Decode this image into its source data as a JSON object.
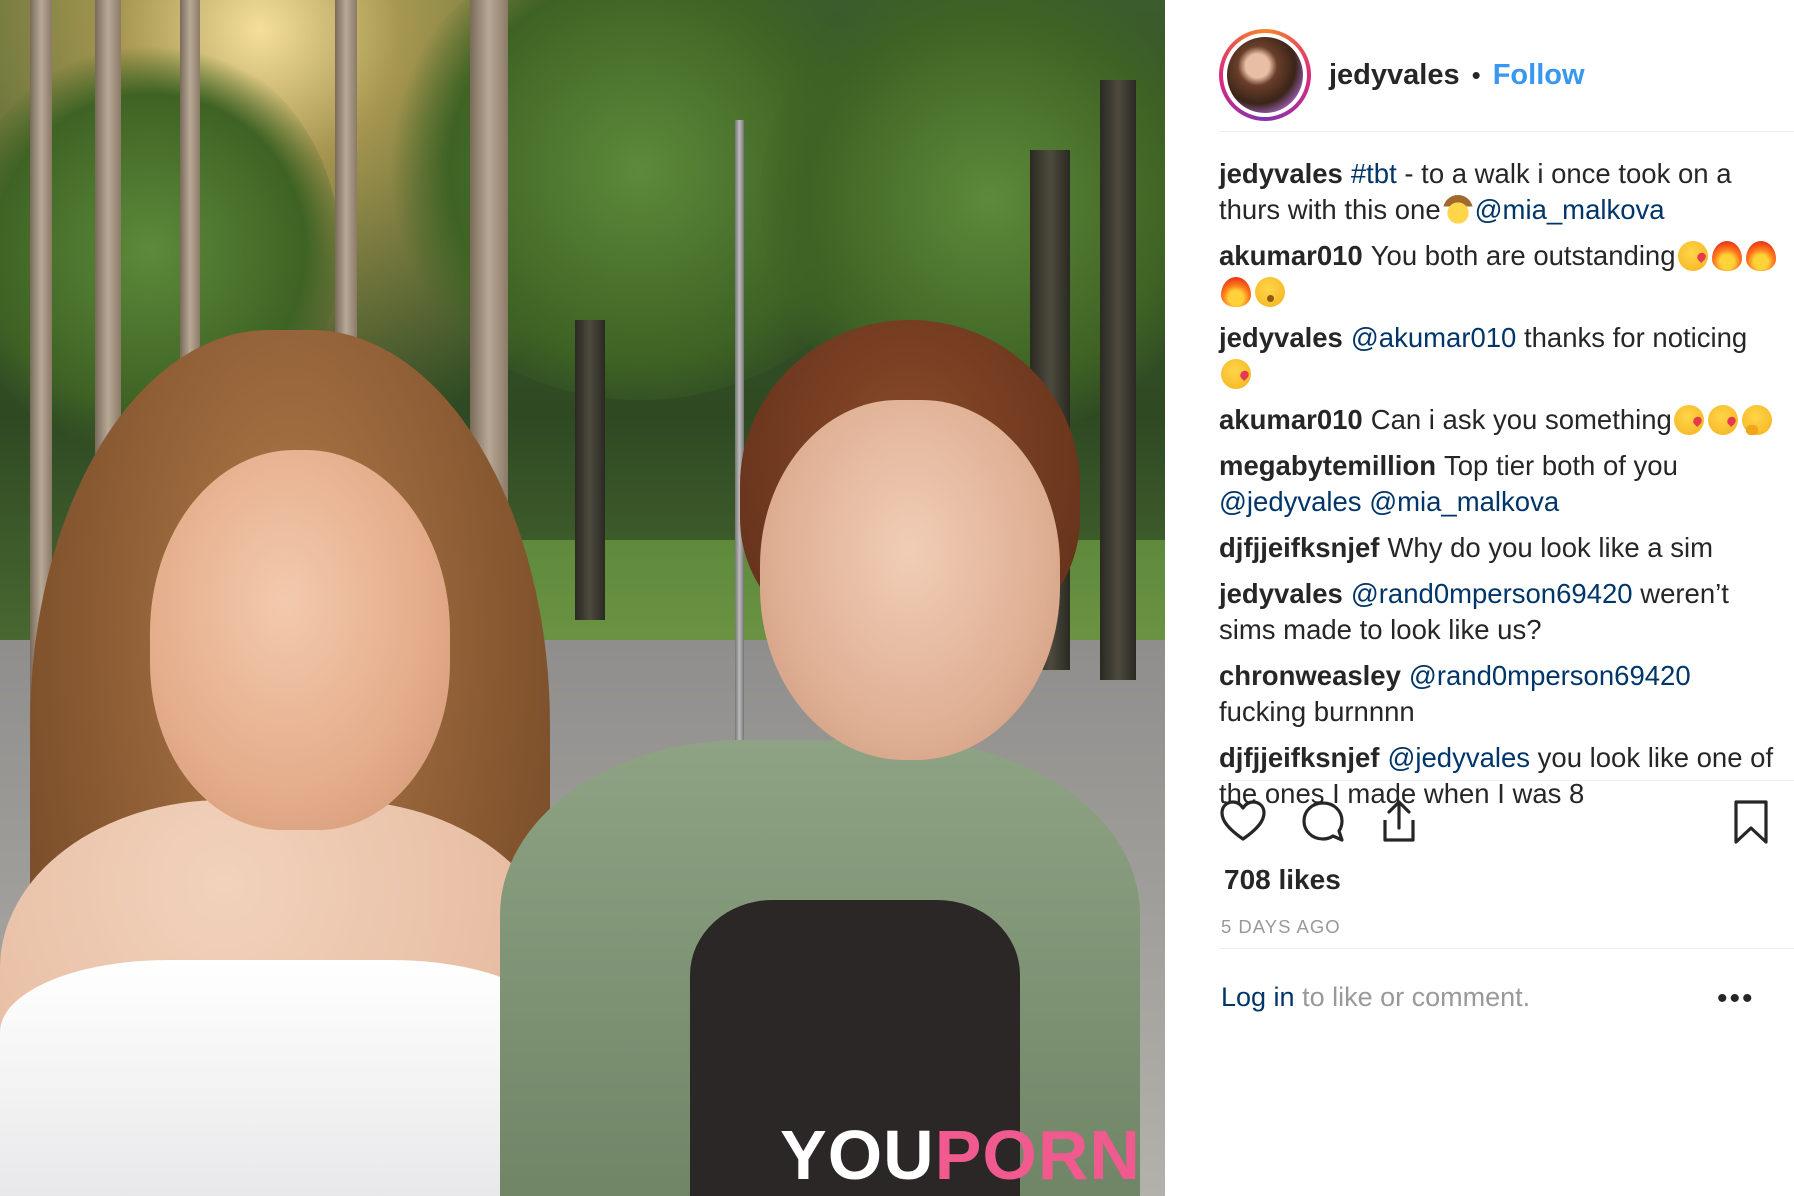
{
  "post": {
    "username": "jedyvales",
    "separator": "•",
    "follow_label": "Follow",
    "photo_logo": {
      "part1": "YOU",
      "part2": "PORN"
    }
  },
  "comments": [
    {
      "user": "jedyvales",
      "parts": [
        {
          "type": "mention",
          "text": "#tbt"
        },
        {
          "type": "text",
          "text": " - to a walk i once took on a thurs with this one"
        },
        {
          "type": "emoji",
          "name": "cowboy-emoji"
        },
        {
          "type": "mention",
          "text": "@mia_malkova"
        }
      ]
    },
    {
      "user": "akumar010",
      "parts": [
        {
          "type": "text",
          "text": "You both are outstanding"
        },
        {
          "type": "emoji",
          "name": "kiss-emoji"
        },
        {
          "type": "emoji",
          "name": "fire-emoji"
        },
        {
          "type": "emoji",
          "name": "fire-emoji"
        },
        {
          "type": "emoji",
          "name": "fire-emoji"
        },
        {
          "type": "emoji",
          "name": "whistle-emoji"
        }
      ]
    },
    {
      "user": "jedyvales",
      "parts": [
        {
          "type": "mention",
          "text": "@akumar010"
        },
        {
          "type": "text",
          "text": " thanks for noticing "
        },
        {
          "type": "emoji",
          "name": "kiss-emoji"
        }
      ]
    },
    {
      "user": "akumar010",
      "parts": [
        {
          "type": "text",
          "text": "Can i ask you something"
        },
        {
          "type": "emoji",
          "name": "kiss-emoji"
        },
        {
          "type": "emoji",
          "name": "kiss-emoji"
        },
        {
          "type": "emoji",
          "name": "think-emoji"
        }
      ]
    },
    {
      "user": "megabytemillion",
      "parts": [
        {
          "type": "text",
          "text": "Top tier both of you "
        },
        {
          "type": "mention",
          "text": "@jedyvales"
        },
        {
          "type": "text",
          "text": " "
        },
        {
          "type": "mention",
          "text": "@mia_malkova"
        }
      ]
    },
    {
      "user": "djfjjeifksnjef",
      "parts": [
        {
          "type": "text",
          "text": "Why do you look like a sim"
        }
      ]
    },
    {
      "user": "jedyvales",
      "parts": [
        {
          "type": "mention",
          "text": "@rand0mperson69420"
        },
        {
          "type": "text",
          "text": " weren’t sims made to look like us?"
        }
      ]
    },
    {
      "user": "chronweasley",
      "parts": [
        {
          "type": "mention",
          "text": "@rand0mperson69420"
        },
        {
          "type": "text",
          "text": " fucking burnnnn"
        }
      ]
    },
    {
      "user": "djfjjeifksnjef",
      "parts": [
        {
          "type": "mention",
          "text": "@jedyvales"
        },
        {
          "type": "text",
          "text": " you look like one of the ones I made when I was 8"
        }
      ]
    }
  ],
  "actions": {
    "icons": [
      "heart-icon",
      "comment-icon",
      "share-icon",
      "bookmark-icon"
    ],
    "likes": "708 likes",
    "timestamp": "5 DAYS AGO"
  },
  "footer": {
    "login_label": "Log in",
    "login_suffix": " to like or comment.",
    "more_label": "•••"
  },
  "colors": {
    "link_blue": "#3897f0",
    "mention_navy": "#003569",
    "text": "#262626",
    "muted": "#999999",
    "divider": "#efefef"
  }
}
